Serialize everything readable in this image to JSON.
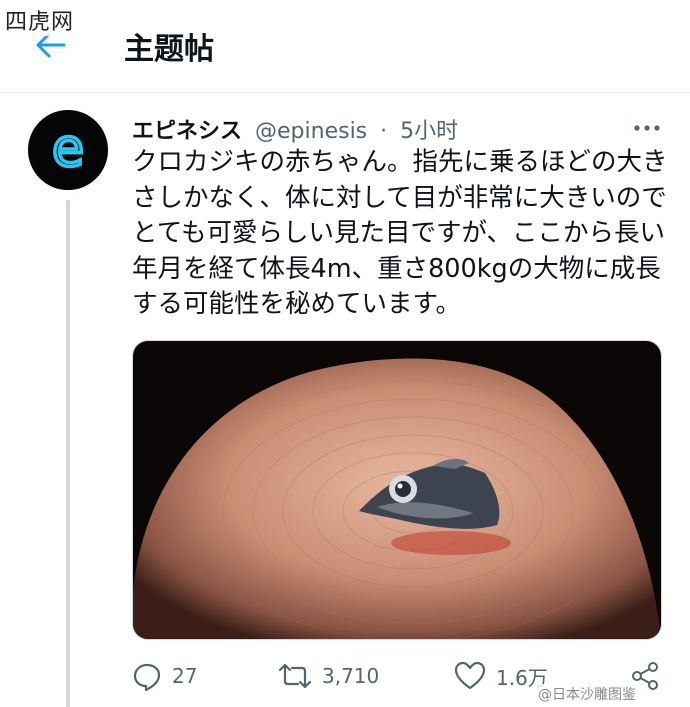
{
  "watermark_top": "四虎网",
  "header": {
    "title": "主题帖"
  },
  "tweet": {
    "avatar_letter": "e",
    "display_name": "エピネシス",
    "handle": "@epinesis",
    "separator": "·",
    "time": "5小时",
    "text_lines": [
      "クロカジキの赤ちゃん。指先に乗るほどの大き",
      "さしかなく、体に対して目が非常に大きいので",
      "とても可愛らしい見た目ですが、ここから長い",
      "年月を経て体長4m、重さ800kgの大物に成長",
      "する可能性を秘めています。"
    ],
    "stats": {
      "replies": "27",
      "retweets": "3,710",
      "likes": "1.6万"
    }
  },
  "watermark_bottom": "@日本沙雕图鉴",
  "icons": {
    "back": "arrow-left-icon",
    "more": "more-dots-icon",
    "reply": "reply-icon",
    "retweet": "retweet-icon",
    "like": "heart-icon",
    "share": "share-icon"
  },
  "colors": {
    "accent": "#1d9bf0",
    "avatar_ring": "#29c7f2",
    "muted": "#536471"
  }
}
